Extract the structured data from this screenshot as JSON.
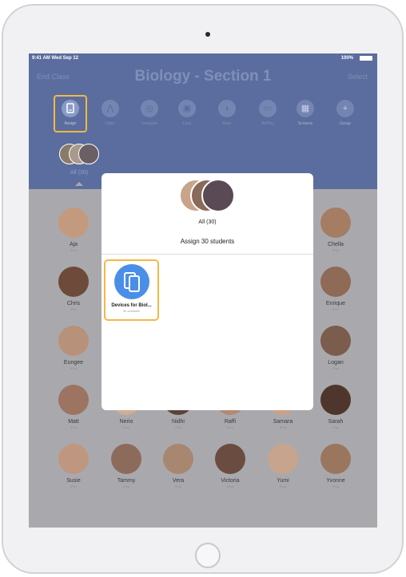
{
  "status_bar": {
    "time": "9:41 AM  Wed Sep 12",
    "battery": "100%"
  },
  "nav": {
    "left": "End Class",
    "title": "Biology - Section 1",
    "right": "Select"
  },
  "toolbar": [
    {
      "label": "Assign",
      "icon": "assign-icon",
      "active": true
    },
    {
      "label": "Open",
      "icon": "open-icon"
    },
    {
      "label": "Navigate",
      "icon": "navigate-icon"
    },
    {
      "label": "Lock",
      "icon": "lock-icon"
    },
    {
      "label": "Mute",
      "icon": "mute-icon"
    },
    {
      "label": "AirPlay",
      "icon": "airplay-icon"
    },
    {
      "label": "Screens",
      "icon": "screens-icon"
    },
    {
      "label": "Group",
      "icon": "group-add-icon"
    }
  ],
  "group": {
    "label": "All (30)"
  },
  "students": [
    {
      "name": "Aja",
      "sub": "iPad"
    },
    {
      "name": "Chella",
      "sub": "iPad"
    },
    {
      "name": "Chris",
      "sub": "iPad"
    },
    {
      "name": "Enrique",
      "sub": "iPad"
    },
    {
      "name": "Eungee",
      "sub": "iPad"
    },
    {
      "name": "Logan",
      "sub": "iPad"
    },
    {
      "name": "Matt",
      "sub": "iPad"
    },
    {
      "name": "Nerio",
      "sub": "iPad"
    },
    {
      "name": "Nidhi",
      "sub": "iPad"
    },
    {
      "name": "Raffi",
      "sub": "iPad"
    },
    {
      "name": "Samara",
      "sub": "iPad"
    },
    {
      "name": "Sarah",
      "sub": "iPad"
    },
    {
      "name": "Susie",
      "sub": "iPad"
    },
    {
      "name": "Tammy",
      "sub": "iPad"
    },
    {
      "name": "Vera",
      "sub": "iPad"
    },
    {
      "name": "Victoria",
      "sub": "iPad"
    },
    {
      "name": "Yumi",
      "sub": "iPad"
    },
    {
      "name": "Yvonne",
      "sub": "iPad"
    }
  ],
  "popover": {
    "group_label": "All (30)",
    "title": "Assign 30 students",
    "device_name": "Devices for Biol...",
    "device_sub": "30 available"
  },
  "colors": {
    "header": "#5b6d9e",
    "accent_highlight": "#f2b845",
    "device_blue": "#4a8fe7"
  }
}
